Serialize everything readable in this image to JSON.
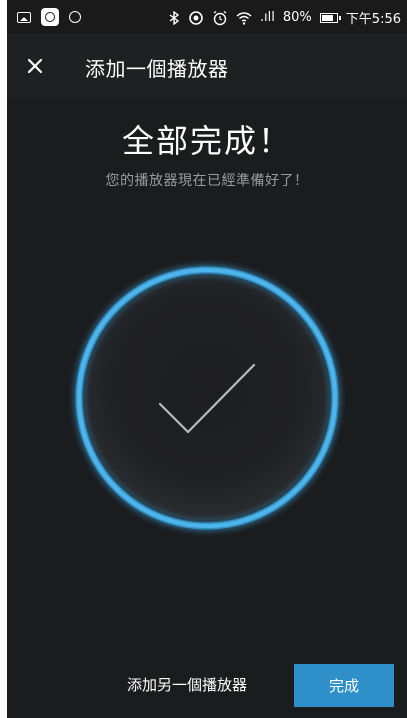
{
  "status_bar": {
    "signal": ".ıll",
    "battery": "80%",
    "time": "下午5:56",
    "icons": [
      "gallery-icon",
      "app-icon",
      "clock-icon",
      "bluetooth-icon",
      "sync-icon",
      "alarm-icon",
      "wifi-icon",
      "signal-icon",
      "battery-icon"
    ]
  },
  "header": {
    "title": "添加一個播放器",
    "close_icon": "close-icon"
  },
  "main": {
    "title": "全部完成！",
    "subtitle": "您的播放器現在已經準備好了！",
    "accent_color": "#3aa6e0",
    "status_icon": "checkmark-icon"
  },
  "footer": {
    "add_another_label": "添加另一個播放器",
    "done_label": "完成",
    "done_color": "#2f8fc9"
  }
}
